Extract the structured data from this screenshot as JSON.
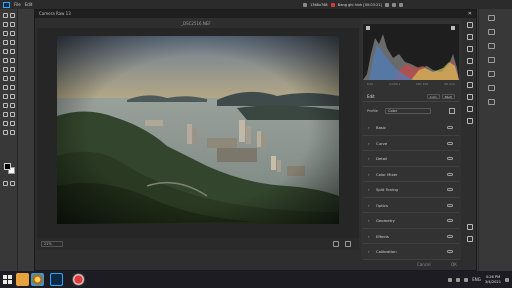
{
  "photoshop": {
    "menu": [
      "File",
      "Edit"
    ],
    "menu_truncated": "Camera Raw 13"
  },
  "recorder_overlay": {
    "resolution": "1366x768",
    "status": "Đang ghi hình [00:03:21]"
  },
  "camera_raw": {
    "title": "Camera Raw 13",
    "filename": "_DSC2516.NEF",
    "zoom": "21%",
    "histogram": {
      "readout": [
        "f/10",
        "1/100 s",
        "ISO 100",
        "50 mm"
      ]
    },
    "edit_panel": {
      "title": "Edit",
      "buttons": [
        "Auto",
        "B&W"
      ],
      "profile_label": "Profile",
      "profile_value": "Color"
    },
    "sections": [
      {
        "name": "Basic"
      },
      {
        "name": "Curve"
      },
      {
        "name": "Detail"
      },
      {
        "name": "Color Mixer"
      },
      {
        "name": "Split Toning"
      },
      {
        "name": "Optics"
      },
      {
        "name": "Geometry"
      },
      {
        "name": "Effects"
      },
      {
        "name": "Calibration"
      }
    ],
    "cancel_label": "Cancel",
    "ok_label": "OK"
  },
  "taskbar": {
    "language": "ENG",
    "time": "4:26 PM",
    "date": "3/4/2021"
  },
  "colors": {
    "accent": "#31a8ff",
    "dialog_bg": "#2e2e2e",
    "panel_bg": "#323232"
  }
}
